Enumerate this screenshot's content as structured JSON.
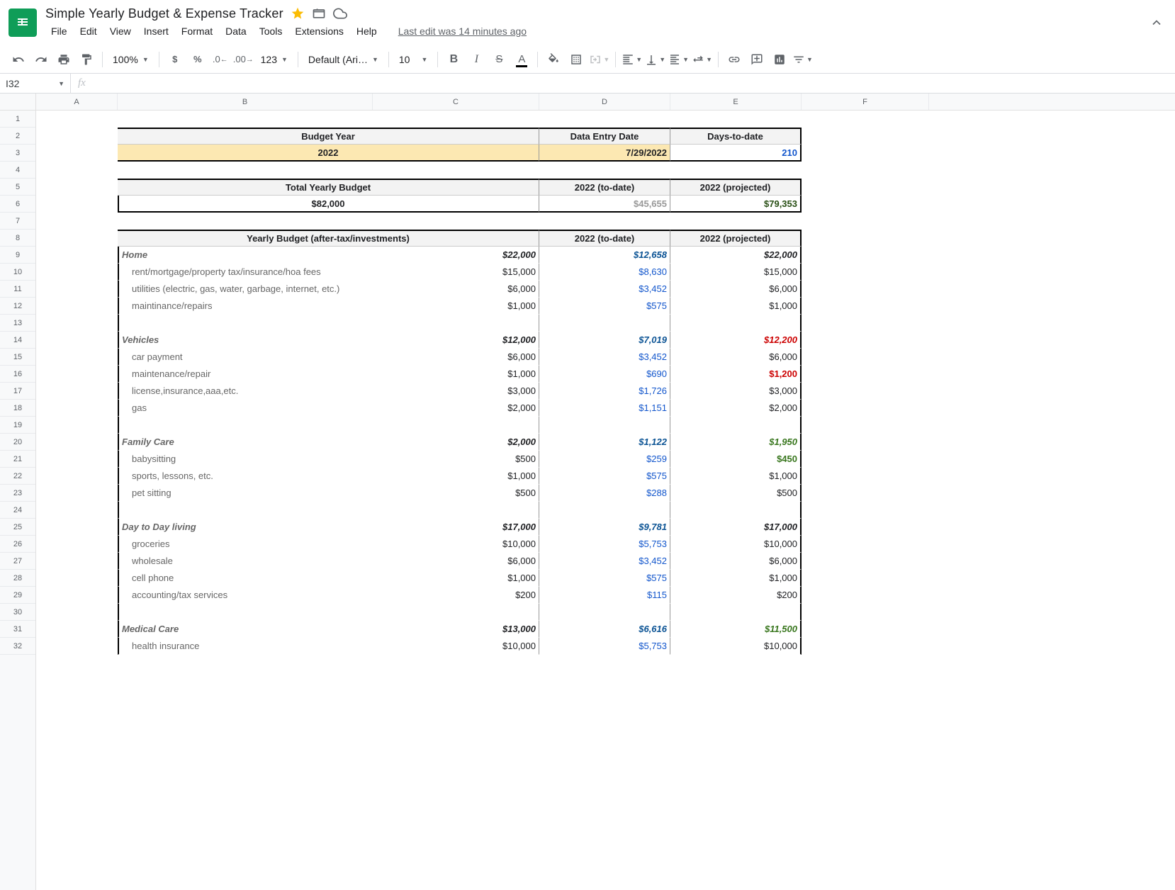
{
  "title": "Simple Yearly Budget & Expense Tracker",
  "menus": {
    "file": "File",
    "edit": "Edit",
    "view": "View",
    "insert": "Insert",
    "format": "Format",
    "data": "Data",
    "tools": "Tools",
    "extensions": "Extensions",
    "help": "Help",
    "lastEdit": "Last edit was 14 minutes ago"
  },
  "toolbar": {
    "zoom": "100%",
    "font": "Default (Ari…",
    "size": "10",
    "fmt123": "123"
  },
  "nameBox": "I32",
  "cols": [
    "A",
    "B",
    "C",
    "D",
    "E",
    "F"
  ],
  "rows": [
    "1",
    "2",
    "3",
    "4",
    "5",
    "6",
    "7",
    "8",
    "9",
    "10",
    "11",
    "12",
    "13",
    "14",
    "15",
    "16",
    "17",
    "18",
    "19",
    "20",
    "21",
    "22",
    "23",
    "24",
    "25",
    "26",
    "27",
    "28",
    "29",
    "30",
    "31",
    "32"
  ],
  "t1": {
    "h1": "Budget Year",
    "h2": "Data Entry Date",
    "h3": "Days-to-date",
    "v1": "2022",
    "v2": "7/29/2022",
    "v3": "210"
  },
  "t2": {
    "h1": "Total Yearly Budget",
    "h2": "2022 (to-date)",
    "h3": "2022 (projected)",
    "v1": "$82,000",
    "v2": "$45,655",
    "v3": "$79,353"
  },
  "t3": {
    "h1": "Yearly Budget (after-tax/investments)",
    "h2": "2022 (to-date)",
    "h3": "2022 (projected)"
  },
  "cats": [
    {
      "label": "Home",
      "b": "$22,000",
      "td": "$12,658",
      "pr": "$22,000",
      "prClass": "bold",
      "items": [
        {
          "l": "rent/mortgage/property tax/insurance/hoa fees",
          "b": "$15,000",
          "td": "$8,630",
          "pr": "$15,000"
        },
        {
          "l": "utilities (electric, gas, water, garbage, internet, etc.)",
          "b": "$6,000",
          "td": "$3,452",
          "pr": "$6,000"
        },
        {
          "l": "maintinance/repairs",
          "b": "$1,000",
          "td": "$575",
          "pr": "$1,000"
        }
      ]
    },
    {
      "label": "Vehicles",
      "b": "$12,000",
      "td": "$7,019",
      "pr": "$12,200",
      "prClass": "red",
      "items": [
        {
          "l": "car payment",
          "b": "$6,000",
          "td": "$3,452",
          "pr": "$6,000"
        },
        {
          "l": "maintenance/repair",
          "b": "$1,000",
          "td": "$690",
          "pr": "$1,200",
          "prClass": "red"
        },
        {
          "l": "license,insurance,aaa,etc.",
          "b": "$3,000",
          "td": "$1,726",
          "pr": "$3,000"
        },
        {
          "l": "gas",
          "b": "$2,000",
          "td": "$1,151",
          "pr": "$2,000"
        }
      ]
    },
    {
      "label": "Family Care",
      "b": "$2,000",
      "td": "$1,122",
      "pr": "$1,950",
      "prClass": "green2",
      "items": [
        {
          "l": "babysitting",
          "b": "$500",
          "td": "$259",
          "pr": "$450",
          "prClass": "green2"
        },
        {
          "l": "sports, lessons, etc.",
          "b": "$1,000",
          "td": "$575",
          "pr": "$1,000"
        },
        {
          "l": "pet sitting",
          "b": "$500",
          "td": "$288",
          "pr": "$500"
        }
      ]
    },
    {
      "label": "Day to Day living",
      "b": "$17,000",
      "td": "$9,781",
      "pr": "$17,000",
      "prClass": "bold",
      "items": [
        {
          "l": "groceries",
          "b": "$10,000",
          "td": "$5,753",
          "pr": "$10,000"
        },
        {
          "l": "wholesale",
          "b": "$6,000",
          "td": "$3,452",
          "pr": "$6,000"
        },
        {
          "l": "cell phone",
          "b": "$1,000",
          "td": "$575",
          "pr": "$1,000"
        },
        {
          "l": "accounting/tax services",
          "b": "$200",
          "td": "$115",
          "pr": "$200"
        }
      ]
    },
    {
      "label": "Medical Care",
      "b": "$13,000",
      "td": "$6,616",
      "pr": "$11,500",
      "prClass": "green2",
      "items": [
        {
          "l": "health insurance",
          "b": "$10,000",
          "td": "$5,753",
          "pr": "$10,000"
        }
      ]
    }
  ]
}
